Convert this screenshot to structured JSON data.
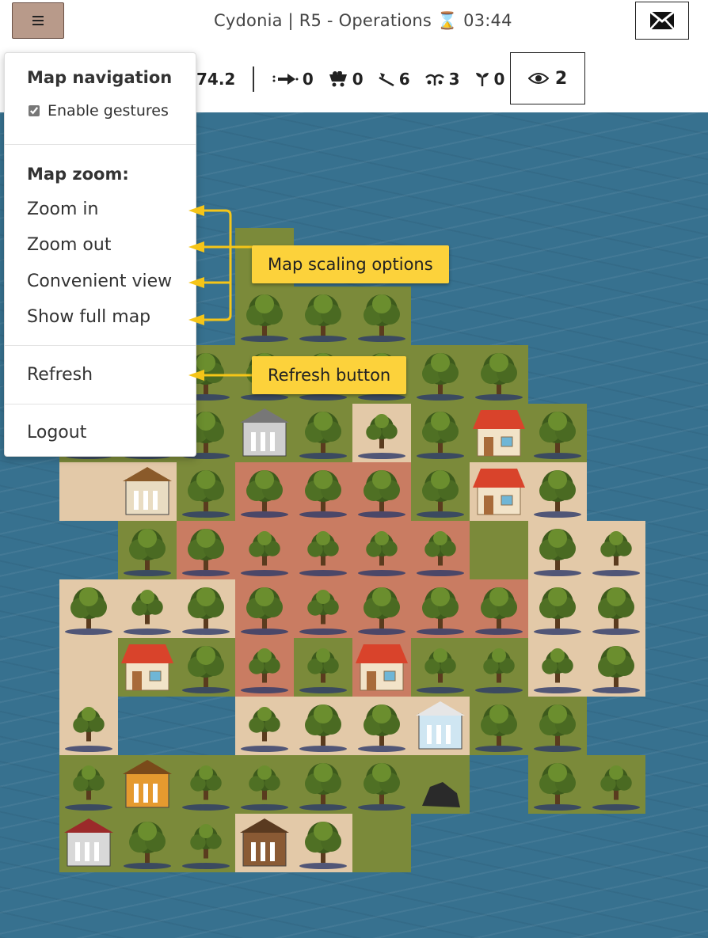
{
  "header": {
    "title": "Cydonia | R5 - Operations ⌛ 03:44",
    "menu_icon": "hamburger-icon",
    "mail_icon": "envelope-icon"
  },
  "stats": {
    "first_value": "74.2",
    "items": [
      {
        "icon": "arrow-icon",
        "value": "0"
      },
      {
        "icon": "cart-icon",
        "value": "0"
      },
      {
        "icon": "axe-icon",
        "value": "6"
      },
      {
        "icon": "sprout-icon",
        "value": "3"
      },
      {
        "icon": "seedling-icon",
        "value": "0"
      }
    ],
    "watchers": {
      "icon": "eye-icon",
      "value": "2"
    }
  },
  "menu": {
    "section_navigation": "Map navigation",
    "gestures_label": "Enable gestures",
    "gestures_checked": true,
    "section_zoom": "Map zoom:",
    "zoom_in": "Zoom in",
    "zoom_out": "Zoom out",
    "convenient_view": "Convenient view",
    "show_full_map": "Show full map",
    "refresh": "Refresh",
    "logout": "Logout"
  },
  "annotations": {
    "scaling": "Map scaling options",
    "refresh": "Refresh button"
  },
  "colors": {
    "water": "#37718f",
    "grass": "#7b8a3a",
    "sand": "#e3c9a8",
    "clay": "#c97c62",
    "callout": "#fcd23b",
    "menu_button": "#b89a8a"
  }
}
